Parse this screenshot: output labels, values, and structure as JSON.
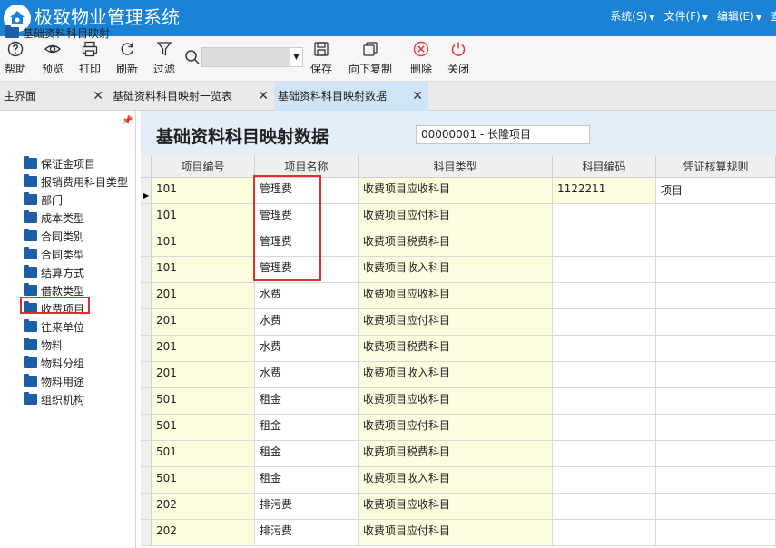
{
  "app": {
    "title": "极致物业管理系统",
    "menu": [
      {
        "label": "系统(S)"
      },
      {
        "label": "文件(F)"
      },
      {
        "label": "编辑(E)"
      },
      {
        "label": "查"
      }
    ]
  },
  "toolbar": {
    "buttons": [
      {
        "label": "帮助",
        "icon": "help-icon"
      },
      {
        "label": "预览",
        "icon": "eye-icon"
      },
      {
        "label": "打印",
        "icon": "printer-icon"
      },
      {
        "label": "刷新",
        "icon": "refresh-icon"
      },
      {
        "label": "过滤",
        "icon": "filter-icon"
      },
      {
        "label": "保存",
        "icon": "save-icon"
      },
      {
        "label": "向下复制",
        "icon": "copy-icon"
      },
      {
        "label": "删除",
        "icon": "delete-icon"
      },
      {
        "label": "关闭",
        "icon": "power-icon"
      }
    ],
    "search_value": ""
  },
  "tabs": [
    {
      "label": "主界面",
      "active": false
    },
    {
      "label": "基础资料科目映射一览表",
      "active": false
    },
    {
      "label": "基础资料科目映射数据",
      "active": true
    }
  ],
  "tree": {
    "root": "基础资料科目映射",
    "items": [
      "保证金项目",
      "报销费用科目类型",
      "部门",
      "成本类型",
      "合同类别",
      "合同类型",
      "结算方式",
      "借款类型",
      "收费项目",
      "往来单位",
      "物料",
      "物料分组",
      "物料用途",
      "组织机构"
    ],
    "selected": "收费项目"
  },
  "main": {
    "title": "基础资料科目映射数据",
    "project": "00000001 - 长隆项目",
    "columns": [
      "项目编号",
      "项目名称",
      "科目类型",
      "科目编码",
      "凭证核算规则"
    ],
    "rows": [
      [
        "101",
        "管理费",
        "收费项目应收科目",
        "1122211",
        "项目"
      ],
      [
        "101",
        "管理费",
        "收费项目应付科目",
        "",
        ""
      ],
      [
        "101",
        "管理费",
        "收费项目税费科目",
        "",
        ""
      ],
      [
        "101",
        "管理费",
        "收费项目收入科目",
        "",
        ""
      ],
      [
        "201",
        "水费",
        "收费项目应收科目",
        "",
        ""
      ],
      [
        "201",
        "水费",
        "收费项目应付科目",
        "",
        ""
      ],
      [
        "201",
        "水费",
        "收费项目税费科目",
        "",
        ""
      ],
      [
        "201",
        "水费",
        "收费项目收入科目",
        "",
        ""
      ],
      [
        "501",
        "租金",
        "收费项目应收科目",
        "",
        ""
      ],
      [
        "501",
        "租金",
        "收费项目应付科目",
        "",
        ""
      ],
      [
        "501",
        "租金",
        "收费项目税费科目",
        "",
        ""
      ],
      [
        "501",
        "租金",
        "收费项目收入科目",
        "",
        ""
      ],
      [
        "202",
        "排污费",
        "收费项目应收科目",
        "",
        ""
      ],
      [
        "202",
        "排污费",
        "收费项目应付科目",
        "",
        ""
      ]
    ]
  },
  "colors": {
    "titlebar": "#1a83d8",
    "highlight": "#e03030",
    "editable_cell": "#fcfcdf",
    "folder": "#1c5fa8"
  }
}
